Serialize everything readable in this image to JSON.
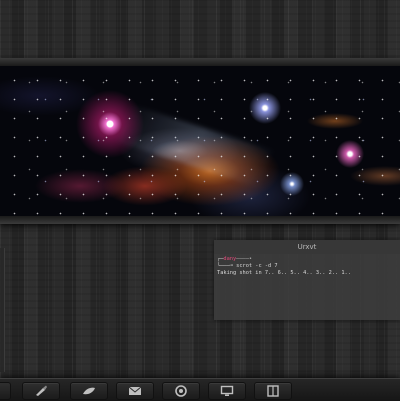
{
  "terminal": {
    "title": "Urxvt",
    "prompt_prefix": "┌─",
    "prompt_user": "dany",
    "prompt_suffix": "────•",
    "prompt_arrow": "└───╼",
    "command": "scrot -c -d 7",
    "output": "Taking shot in 7.. 6.. 5.. 4.. 3.. 2.. 1.."
  },
  "dock": {
    "items": [
      {
        "icon": "paintbrush-icon"
      },
      {
        "icon": "leaf-icon"
      },
      {
        "icon": "mail-icon"
      },
      {
        "icon": "firefox-icon"
      },
      {
        "icon": "monitor-icon"
      },
      {
        "icon": "book-icon"
      }
    ]
  },
  "colors": {
    "accent_user": "#e24a7a",
    "terminal_bg": "#3c3c3c",
    "dock_bg": "#1e1e1e"
  }
}
